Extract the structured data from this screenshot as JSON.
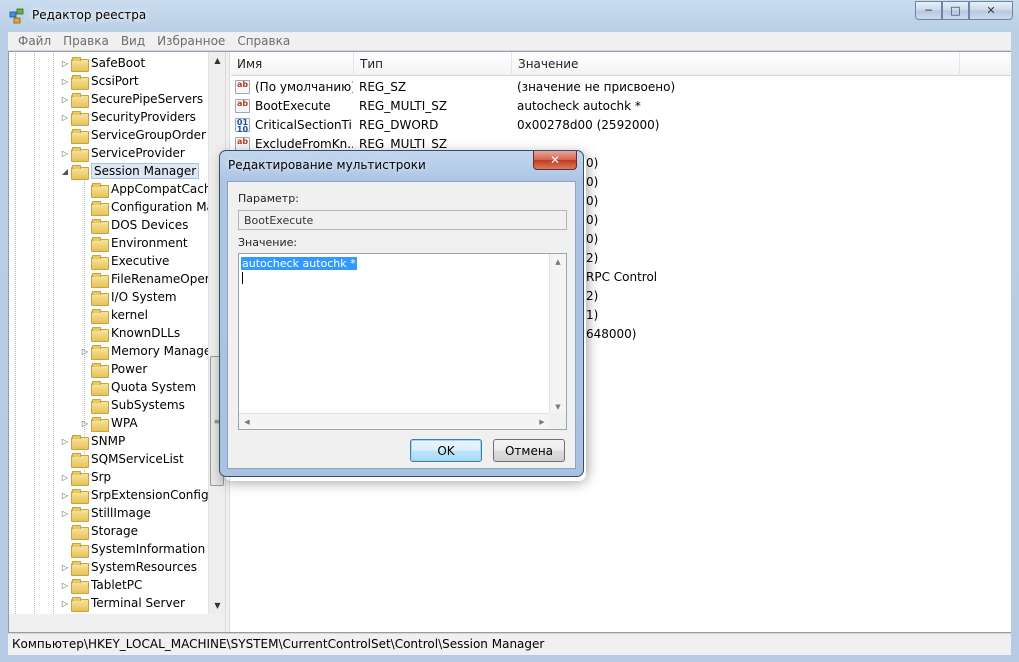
{
  "window": {
    "title": "Редактор реестра",
    "caption_buttons": [
      "─",
      "□",
      "✕"
    ]
  },
  "menu": [
    "Файл",
    "Правка",
    "Вид",
    "Избранное",
    "Справка"
  ],
  "tree": {
    "items": [
      {
        "label": "SafeBoot",
        "expandable": true,
        "level": 0
      },
      {
        "label": "ScsiPort",
        "expandable": true,
        "level": 0
      },
      {
        "label": "SecurePipeServers",
        "expandable": true,
        "level": 0
      },
      {
        "label": "SecurityProviders",
        "expandable": true,
        "level": 0
      },
      {
        "label": "ServiceGroupOrder",
        "expandable": false,
        "level": 0
      },
      {
        "label": "ServiceProvider",
        "expandable": true,
        "level": 0
      },
      {
        "label": "Session Manager",
        "expandable": true,
        "expanded": true,
        "selected": true,
        "level": 0
      },
      {
        "label": "AppCompatCache",
        "expandable": false,
        "level": 1
      },
      {
        "label": "Configuration Manager",
        "expandable": false,
        "level": 1
      },
      {
        "label": "DOS Devices",
        "expandable": false,
        "level": 1
      },
      {
        "label": "Environment",
        "expandable": false,
        "level": 1
      },
      {
        "label": "Executive",
        "expandable": false,
        "level": 1
      },
      {
        "label": "FileRenameOperations",
        "expandable": false,
        "level": 1
      },
      {
        "label": "I/O System",
        "expandable": false,
        "level": 1
      },
      {
        "label": "kernel",
        "expandable": false,
        "level": 1
      },
      {
        "label": "KnownDLLs",
        "expandable": false,
        "level": 1
      },
      {
        "label": "Memory Management",
        "expandable": true,
        "level": 1
      },
      {
        "label": "Power",
        "expandable": false,
        "level": 1
      },
      {
        "label": "Quota System",
        "expandable": false,
        "level": 1
      },
      {
        "label": "SubSystems",
        "expandable": false,
        "level": 1
      },
      {
        "label": "WPA",
        "expandable": true,
        "level": 1
      },
      {
        "label": "SNMP",
        "expandable": true,
        "level": 0
      },
      {
        "label": "SQMServiceList",
        "expandable": false,
        "level": 0
      },
      {
        "label": "Srp",
        "expandable": true,
        "level": 0
      },
      {
        "label": "SrpExtensionConfig",
        "expandable": true,
        "level": 0
      },
      {
        "label": "StillImage",
        "expandable": true,
        "level": 0
      },
      {
        "label": "Storage",
        "expandable": false,
        "level": 0
      },
      {
        "label": "SystemInformation",
        "expandable": false,
        "level": 0
      },
      {
        "label": "SystemResources",
        "expandable": true,
        "level": 0
      },
      {
        "label": "TabletPC",
        "expandable": true,
        "level": 0
      },
      {
        "label": "Terminal Server",
        "expandable": true,
        "level": 0
      }
    ]
  },
  "list": {
    "columns": [
      "Имя",
      "Тип",
      "Значение"
    ],
    "rows": [
      {
        "icon": "string-value-icon",
        "name": "(По умолчанию)",
        "type": "REG_SZ",
        "value": "(значение не присвоено)"
      },
      {
        "icon": "string-value-icon",
        "name": "BootExecute",
        "type": "REG_MULTI_SZ",
        "value": "autocheck autochk *"
      },
      {
        "icon": "binary-value-icon",
        "name": "CriticalSectionTi...",
        "type": "REG_DWORD",
        "value": "0x00278d00 (2592000)"
      },
      {
        "icon": "string-value-icon",
        "name": "ExcludeFromKn...",
        "type": "REG_MULTI_SZ",
        "value": ""
      }
    ],
    "partial_values": [
      "0)",
      "0)",
      "0)",
      "0)",
      "0)",
      "2)",
      "RPC Control",
      "2)",
      "1)",
      "648000)"
    ]
  },
  "dialog": {
    "title": "Редактирование мультистроки",
    "close_label": "✕",
    "param_label": "Параметр:",
    "param_value": "BootExecute",
    "value_label": "Значение:",
    "value_text": "autocheck autochk *",
    "ok_label": "OK",
    "cancel_label": "Отмена"
  },
  "statusbar": {
    "path": "Компьютер\\HKEY_LOCAL_MACHINE\\SYSTEM\\CurrentControlSet\\Control\\Session Manager"
  }
}
